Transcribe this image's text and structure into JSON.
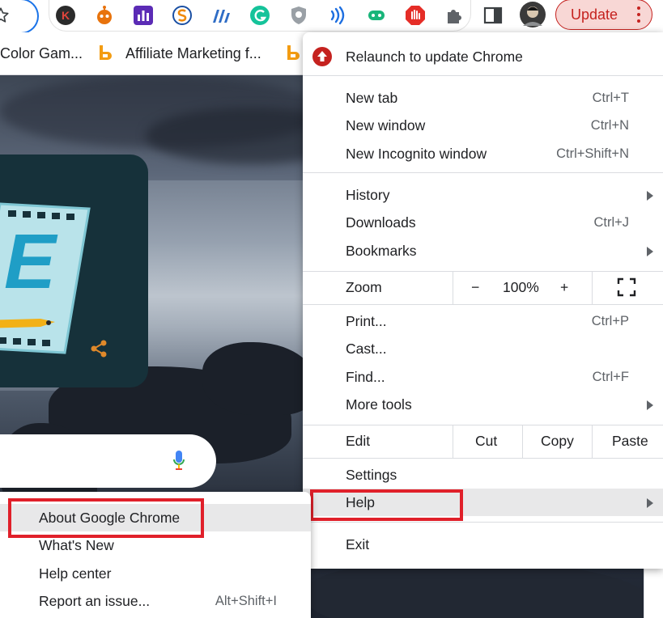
{
  "toolbar": {
    "update_label": "Update",
    "extensions": [
      "kaspersky-icon",
      "reddit-bot-icon",
      "analytics-icon",
      "s-logo-icon",
      "chart-logo-icon",
      "grammarly-icon",
      "shield-ext-icon",
      "wifi-ext-icon",
      "bot-ext-icon",
      "stop-hand-icon",
      "puzzle-icon"
    ]
  },
  "bookmarks": [
    {
      "label": "Color Gam..."
    },
    {
      "label": "Affiliate Marketing f..."
    }
  ],
  "menu": {
    "relaunch": "Relaunch to update Chrome",
    "items": [
      {
        "label": "New tab",
        "shortcut": "Ctrl+T"
      },
      {
        "label": "New window",
        "shortcut": "Ctrl+N"
      },
      {
        "label": "New Incognito window",
        "shortcut": "Ctrl+Shift+N"
      },
      {
        "label": "History",
        "shortcut": ""
      },
      {
        "label": "Downloads",
        "shortcut": "Ctrl+J"
      },
      {
        "label": "Bookmarks",
        "shortcut": ""
      },
      {
        "label": "Print...",
        "shortcut": "Ctrl+P"
      },
      {
        "label": "Cast...",
        "shortcut": ""
      },
      {
        "label": "Find...",
        "shortcut": "Ctrl+F"
      },
      {
        "label": "More tools",
        "shortcut": ""
      },
      {
        "label": "Settings",
        "shortcut": ""
      },
      {
        "label": "Help",
        "shortcut": ""
      },
      {
        "label": "Exit",
        "shortcut": ""
      }
    ],
    "zoom": {
      "label": "Zoom",
      "minus": "−",
      "value": "100%",
      "plus": "+"
    },
    "edit": {
      "label": "Edit",
      "cut": "Cut",
      "copy": "Copy",
      "paste": "Paste"
    }
  },
  "help_submenu": [
    {
      "label": "About Google Chrome",
      "shortcut": ""
    },
    {
      "label": "What's New",
      "shortcut": ""
    },
    {
      "label": "Help center",
      "shortcut": ""
    },
    {
      "label": "Report an issue...",
      "shortcut": "Alt+Shift+I"
    }
  ],
  "colors": {
    "accent": "#1a73e8",
    "update_red": "#c5221f",
    "highlight_red": "#e0202a"
  }
}
